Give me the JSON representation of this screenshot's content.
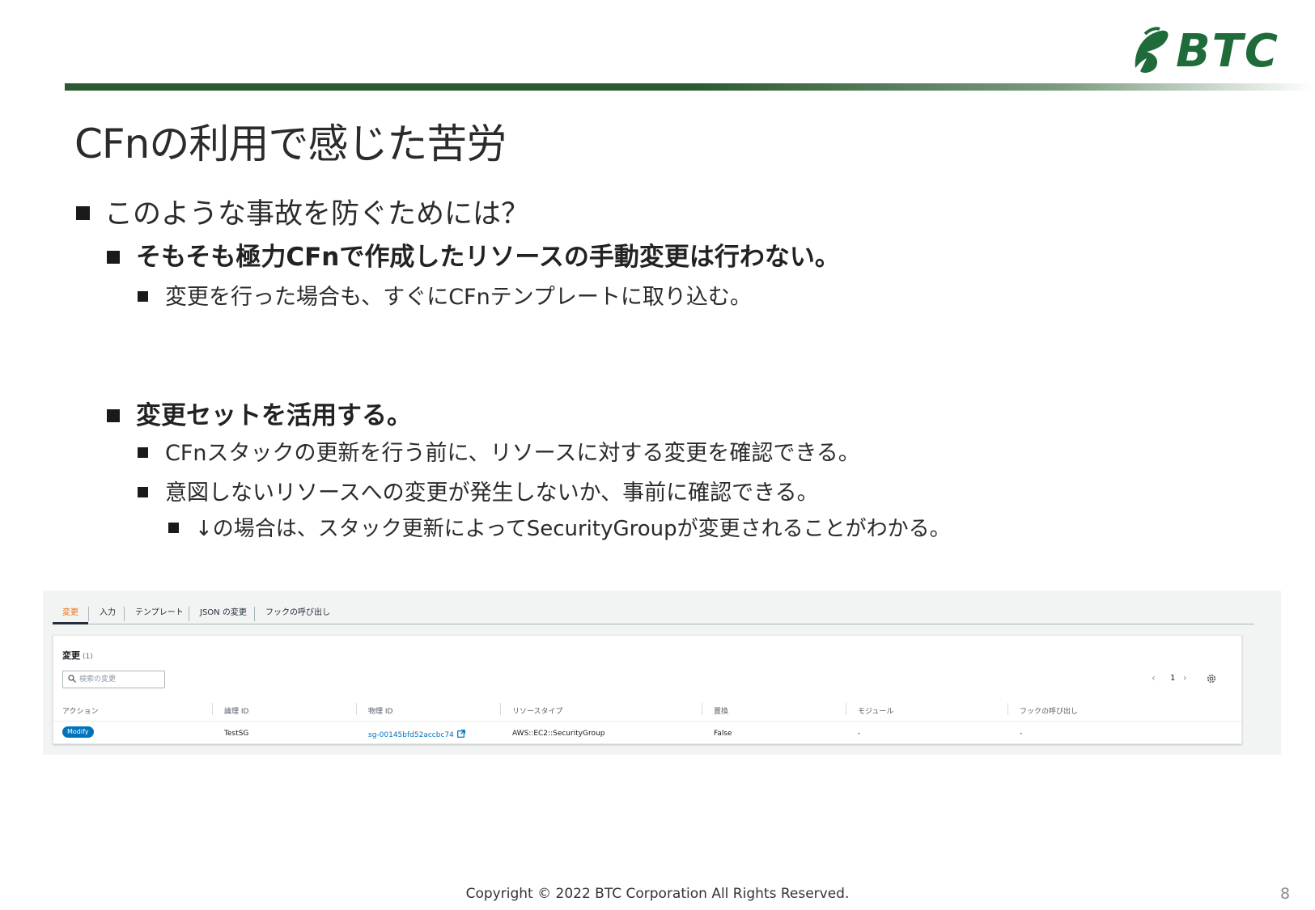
{
  "logo": {
    "text": "BTC",
    "color": "#1f6b3a"
  },
  "header": {
    "bar_color": "#2a5a31"
  },
  "title": "CFnの利用で感じた苦労",
  "bullets": {
    "q": "このような事故を防ぐためには？",
    "a1": "そもそも極力CFnで作成したリソースの手動変更は行わない。",
    "a1_sub1": "変更を行った場合も、すぐにCFnテンプレートに取り込む。",
    "a2": "変更セットを活用する。",
    "a2_sub1": "CFnスタックの更新を行う前に、リソースに対する変更を確認できる。",
    "a2_sub2": "意図しないリソースへの変更が発生しないか、事前に確認できる。",
    "a2_sub2_sub1": "↓の場合は、スタック更新によってSecurityGroupが変更されることがわかる。"
  },
  "console": {
    "tabs": [
      "変更",
      "入力",
      "テンプレート",
      "JSON の変更",
      "フックの呼び出し"
    ],
    "active_tab": "変更",
    "panel_title": "変更",
    "panel_count": "(1)",
    "search_placeholder": "検索の変更",
    "pager_prev": "‹",
    "pager_page": "1",
    "pager_next": "›",
    "columns": [
      "アクション",
      "論理 ID",
      "物理 ID",
      "リソースタイプ",
      "置換",
      "モジュール",
      "フックの呼び出し"
    ],
    "row": {
      "action": "Modify",
      "logical_id": "TestSG",
      "physical_id": "sg-00145bfd52accbc74",
      "resource_type": "AWS::EC2::SecurityGroup",
      "replacement": "False",
      "module": "-",
      "hooks": "-"
    },
    "accent_color": "#ec7211",
    "link_color": "#0073bb"
  },
  "footer": "Copyright © 2022 BTC Corporation All Rights Reserved.",
  "page_number": "8"
}
